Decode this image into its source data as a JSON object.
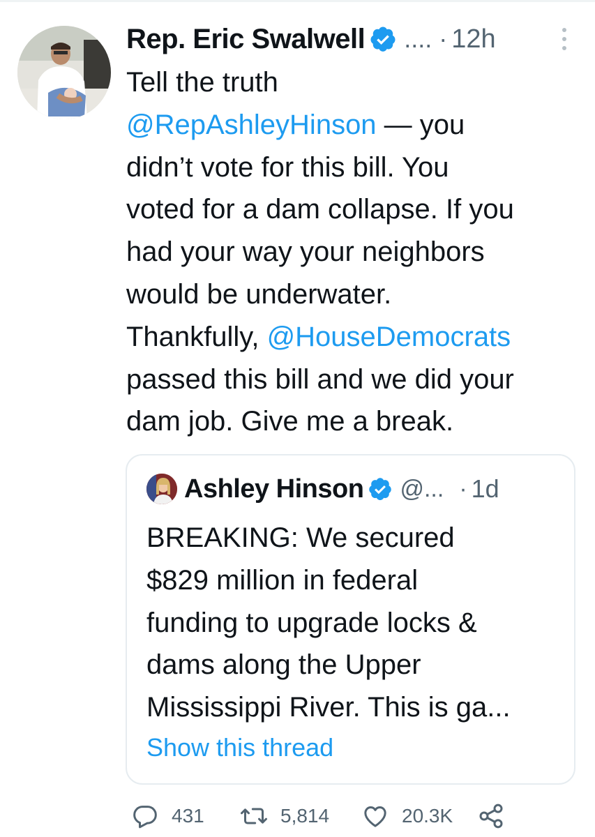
{
  "tweet": {
    "author": {
      "display_name": "Rep. Eric Swalwell",
      "handle": "....",
      "verified": true,
      "time": "12h",
      "time_separator": "·"
    },
    "text_lines": [
      [
        {
          "t": "Tell the truth"
        }
      ],
      [
        {
          "t": "@RepAshleyHinson",
          "m": true
        },
        {
          "t": " — you"
        }
      ],
      [
        {
          "t": "didn’t vote for this bill. You"
        }
      ],
      [
        {
          "t": "voted for a dam collapse. If you"
        }
      ],
      [
        {
          "t": "had your way your neighbors"
        }
      ],
      [
        {
          "t": "would be underwater."
        }
      ],
      [
        {
          "t": "Thankfully, "
        },
        {
          "t": "@HouseDemocrats",
          "m": true
        }
      ],
      [
        {
          "t": "passed this bill and we did your"
        }
      ],
      [
        {
          "t": "dam job. Give me a break."
        }
      ]
    ],
    "quoted": {
      "display_name": "Ashley Hinson",
      "verified": true,
      "handle": "@...",
      "time_separator": "·",
      "time": "1d",
      "text_lines": [
        "BREAKING: We secured",
        "$829 million in federal",
        "funding to upgrade locks &",
        "dams along the Upper",
        "Mississippi River. This is ga..."
      ],
      "show_thread": "Show this thread"
    },
    "actions": {
      "replies": "431",
      "retweets": "5,814",
      "likes": "20.3K"
    }
  },
  "colors": {
    "link": "#1d9bf0",
    "secondary_text": "#536471",
    "primary_text": "#0f1419",
    "border": "#e6ecf0"
  },
  "icons": [
    "kebab-menu-icon",
    "verified-badge-icon",
    "reply-icon",
    "retweet-icon",
    "like-icon",
    "share-icon"
  ]
}
